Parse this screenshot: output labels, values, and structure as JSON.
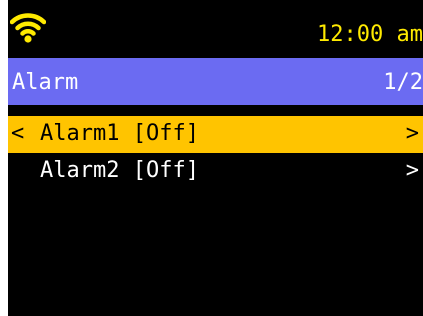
{
  "status_bar": {
    "wifi_icon": "wifi-icon",
    "time": "12:00 am",
    "time_color": "#ffea00"
  },
  "header": {
    "title": "Alarm",
    "page_indicator": "1/2",
    "background_color": "#6b6bf2"
  },
  "menu": {
    "selection_color": "#ffc400",
    "back_glyph": "<",
    "items": [
      {
        "label": "Alarm1 [Off]",
        "chevron": ">",
        "selected": true
      },
      {
        "label": "Alarm2 [Off]",
        "chevron": ">",
        "selected": false
      }
    ]
  }
}
